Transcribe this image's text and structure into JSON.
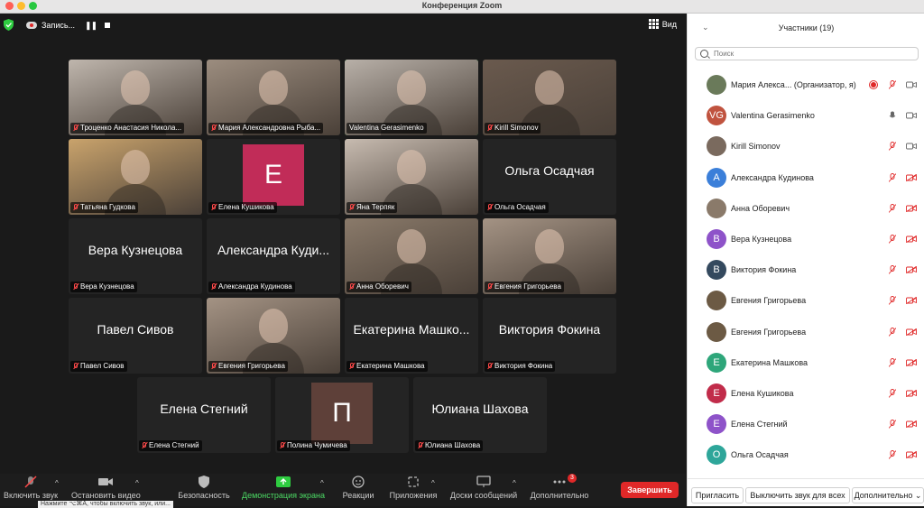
{
  "window": {
    "title": "Конференция Zoom"
  },
  "topbar": {
    "recording_label": "Запись...",
    "view_label": "Вид"
  },
  "tiles": [
    {
      "name": "Троценко Анастасия Никола...",
      "big": "",
      "kind": "photo",
      "color": "#bfb6ad"
    },
    {
      "name": "Мария Александровна Рыба...",
      "big": "",
      "kind": "photo",
      "color": "#9c8d7f"
    },
    {
      "name": "Valentina Gerasimenko",
      "big": "",
      "kind": "photo",
      "color": "#b8b0a8",
      "active": true
    },
    {
      "name": "Kirill Simonov",
      "big": "",
      "kind": "photo",
      "color": "#6a5a4e"
    },
    {
      "name": "Татьяна Гудкова",
      "big": "",
      "kind": "photo",
      "color": "#c9a36c"
    },
    {
      "name": "Елена Кушикова",
      "big": "Е",
      "kind": "letter",
      "color": "#c12c58"
    },
    {
      "name": "Яна Терпяк",
      "big": "",
      "kind": "photo",
      "color": "#c7bbb0"
    },
    {
      "name": "Ольга Осадчая",
      "big": "Ольга Осадчая",
      "kind": "text"
    },
    {
      "name": "Вера Кузнецова",
      "big": "Вера Кузнецова",
      "kind": "text"
    },
    {
      "name": "Александра Кудинова",
      "big": "Александра Куди...",
      "kind": "text"
    },
    {
      "name": "Анна Оборевич",
      "big": "",
      "kind": "photo",
      "color": "#8a7a6a"
    },
    {
      "name": "Евгения Григорьева",
      "big": "",
      "kind": "photo",
      "color": "#a49384"
    },
    {
      "name": "Павел Сивов",
      "big": "Павел Сивов",
      "kind": "text"
    },
    {
      "name": "Евгения Григорьева",
      "big": "",
      "kind": "photo",
      "color": "#a49384"
    },
    {
      "name": "Екатерина Машкова",
      "big": "Екатерина Машко...",
      "kind": "text"
    },
    {
      "name": "Виктория Фокина",
      "big": "Виктория Фокина",
      "kind": "text"
    },
    {
      "name": "Елена Стегний",
      "big": "Елена Стегний",
      "kind": "text"
    },
    {
      "name": "Полина Чумичева",
      "big": "П",
      "kind": "letter",
      "color": "#5e4039"
    },
    {
      "name": "Юлиана Шахова",
      "big": "Юлиана Шахова",
      "kind": "text"
    }
  ],
  "toolbar": {
    "mic_label": "Включить звук",
    "video_label": "Остановить видео",
    "security_label": "Безопасность",
    "share_label": "Демонстрация экрана",
    "reactions_label": "Реакции",
    "apps_label": "Приложения",
    "whiteboard_label": "Доски сообщений",
    "more_label": "Дополнительно",
    "more_badge": "3",
    "end_label": "Завершить",
    "tooltip": "Нажмите ⌥⌘A, чтобы включить звук, или..."
  },
  "panel": {
    "title": "Участники (19)",
    "search_placeholder": "Поиск",
    "participants": [
      {
        "name": "Мария Алекса...",
        "suffix": "(Организатор, я)",
        "avatar": "",
        "color": "#6a7a5a",
        "mic": "off",
        "cam": "on",
        "rec": true
      },
      {
        "name": "Valentina Gerasimenko",
        "avatar": "VG",
        "color": "#c0533f",
        "mic": "on",
        "cam": "on"
      },
      {
        "name": "Kirill Simonov",
        "avatar": "",
        "color": "#7a6a5e",
        "mic": "off",
        "cam": "on"
      },
      {
        "name": "Александра Кудинова",
        "avatar": "А",
        "color": "#3b7fd9",
        "mic": "off",
        "cam": "off"
      },
      {
        "name": "Анна Оборевич",
        "avatar": "",
        "color": "#8a7a6a",
        "mic": "off",
        "cam": "off"
      },
      {
        "name": "Вера Кузнецова",
        "avatar": "В",
        "color": "#8e53c9",
        "mic": "off",
        "cam": "off"
      },
      {
        "name": "Виктория Фокина",
        "avatar": "В",
        "color": "#34495e",
        "mic": "off",
        "cam": "off"
      },
      {
        "name": "Евгения Григорьева",
        "avatar": "",
        "color": "#6c5a44",
        "mic": "off",
        "cam": "off"
      },
      {
        "name": "Евгения Григорьева",
        "avatar": "",
        "color": "#6c5a44",
        "mic": "off",
        "cam": "off"
      },
      {
        "name": "Екатерина Машкова",
        "avatar": "Е",
        "color": "#2ea67a",
        "mic": "off",
        "cam": "off"
      },
      {
        "name": "Елена Кушикова",
        "avatar": "Е",
        "color": "#c12c4a",
        "mic": "off",
        "cam": "off"
      },
      {
        "name": "Елена Стегний",
        "avatar": "Е",
        "color": "#8e53c9",
        "mic": "off",
        "cam": "off"
      },
      {
        "name": "Ольга Осадчая",
        "avatar": "О",
        "color": "#2ea69a",
        "mic": "off",
        "cam": "off"
      }
    ],
    "footer": {
      "invite": "Пригласить",
      "mute_all": "Выключить звук для всех",
      "more": "Дополнительно"
    }
  }
}
